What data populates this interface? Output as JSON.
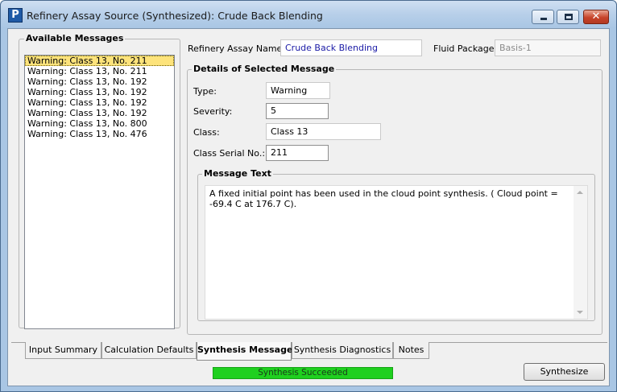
{
  "window": {
    "title": "Refinery Assay Source (Synthesized): Crude Back Blending",
    "app_icon_letter": "P",
    "close_glyph": "✕"
  },
  "available_messages": {
    "label": "Available Messages",
    "items": [
      "Warning: Class 13, No. 211",
      "Warning: Class 13, No. 211",
      "Warning: Class 13, No. 192",
      "Warning: Class 13, No. 192",
      "Warning: Class 13, No. 192",
      "Warning: Class 13, No. 192",
      "Warning: Class 13, No. 800",
      "Warning: Class 13, No. 476"
    ],
    "selected_index": 0
  },
  "header": {
    "assay_name_label": "Refinery Assay Name:",
    "assay_name_value": "Crude Back Blending",
    "fluid_package_label": "Fluid Package:",
    "fluid_package_value": "Basis-1"
  },
  "details": {
    "label": "Details of Selected Message",
    "type_label": "Type:",
    "type_value": "Warning",
    "severity_label": "Severity:",
    "severity_value": "5",
    "class_label": "Class:",
    "class_value": "Class 13",
    "serial_label": "Class Serial No.:",
    "serial_value": "211",
    "message_text_label": "Message Text",
    "message_text": "A fixed initial point has been used in the cloud point synthesis. ( Cloud point = -69.4 C at 176.7 C)."
  },
  "tabs": [
    "Input Summary",
    "Calculation Defaults",
    "Synthesis Messages",
    "Synthesis Diagnostics",
    "Notes"
  ],
  "active_tab": "Synthesis Messages",
  "status": {
    "text": "Synthesis Succeeded",
    "color": "#1fd01f"
  },
  "actions": {
    "synthesize_label": "Synthesize"
  }
}
